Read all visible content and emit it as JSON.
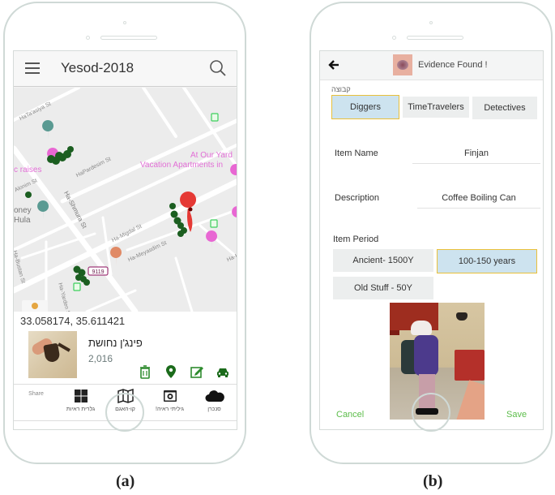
{
  "figure": {
    "captions": [
      "(a)",
      "(b)"
    ]
  },
  "screen_a": {
    "header": {
      "title": "Yesod-2018",
      "menu_icon": "hamburger-menu-icon",
      "search_icon": "search-icon"
    },
    "map": {
      "street_labels": [
        "HaTa'asiya St",
        "HaPardesim St",
        "Alonim St",
        "Ha-Shmura St",
        "Ha-Migdal St",
        "Ha-Meyasdim St",
        "Ha-Bustan St",
        "Ha-Yarden St",
        "Ha-K"
      ],
      "poi_labels": [
        "At Our Yard",
        "Vacation Apartments in",
        "c raises",
        "oney",
        "Hula"
      ],
      "route_badge": "9119",
      "marker_color": "#e53935",
      "cluster_color": "#1b5e20"
    },
    "coordinates": "33.058174, 35.611421",
    "item": {
      "name": "פינג'ן נחושת",
      "year": "2,016",
      "actions": [
        "trash-icon",
        "location-pin-icon",
        "edit-icon",
        "car-icon"
      ]
    },
    "bottom_nav": {
      "share_label": "Share",
      "items": [
        {
          "label": "גלרית ראיות",
          "icon": "grid-icon"
        },
        {
          "label": "קו-האגם",
          "icon": "map-icon"
        },
        {
          "label": "גיליתי ראיה!",
          "icon": "camera-icon"
        },
        {
          "label": "סנכרן",
          "icon": "cloud-icon"
        }
      ]
    },
    "accent_color": "#2e8b2e"
  },
  "screen_b": {
    "header": {
      "title": "Evidence Found !",
      "back_icon": "back-arrow-icon"
    },
    "group_label": "קבוצה",
    "groups": [
      {
        "label": "Diggers",
        "selected": true
      },
      {
        "label": "TimeTravelers",
        "selected": false
      },
      {
        "label": "Detectives",
        "selected": false
      }
    ],
    "fields": {
      "item_name_label": "Item Name",
      "item_name_value": "Finjan",
      "description_label": "Description",
      "description_value": "Coffee Boiling Can"
    },
    "period_label": "Item Period",
    "periods": [
      {
        "label": "Ancient- 1500Y",
        "selected": false
      },
      {
        "label": "100-150 years",
        "selected": true
      },
      {
        "label": "Old Stuff - 50Y",
        "selected": false
      }
    ],
    "cancel_label": "Cancel",
    "save_label": "Save",
    "selected_border_color": "#e9c03a",
    "selected_fill_color": "#cde3ef",
    "action_color": "#5cbd4a"
  }
}
